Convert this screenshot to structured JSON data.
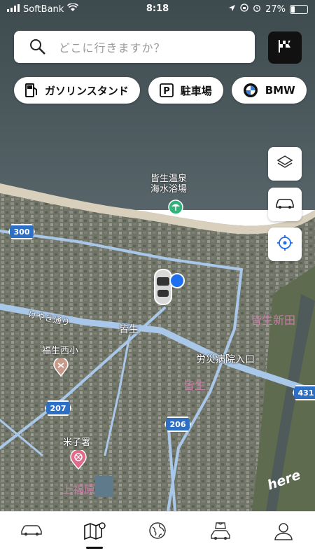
{
  "status_bar": {
    "carrier": "SoftBank",
    "time": "8:18",
    "battery": "27%",
    "battery_level": 0.27
  },
  "search": {
    "placeholder": "どこに行きますか？"
  },
  "chips": [
    {
      "label": "ガソリンスタンド",
      "icon": "gas-station-icon"
    },
    {
      "label": "駐車場",
      "icon": "parking-icon"
    },
    {
      "label": "BMW",
      "icon": "bmw-logo-icon"
    }
  ],
  "map_buttons": [
    {
      "name": "layers-button",
      "icon": "layers-icon"
    },
    {
      "name": "vehicle-button",
      "icon": "car-icon"
    },
    {
      "name": "locate-button",
      "icon": "location-target-icon"
    }
  ],
  "map_labels": {
    "onsen": "皆生温泉\n海水浴場",
    "keyaki": "けやき通り",
    "kaike": "皆生",
    "kaike_shinden": "皆生新田",
    "fukuseinishi": "福生西小",
    "rosai": "労災病院入口",
    "kaike_area": "皆生",
    "yonago_police": "米子署",
    "kamifukuhara": "上福原",
    "here": "here"
  },
  "route_shields": [
    "300",
    "207",
    "206",
    "431"
  ],
  "tabbar": [
    {
      "name": "tab-vehicle",
      "icon": "car-icon"
    },
    {
      "name": "tab-map",
      "icon": "map-icon",
      "active": true
    },
    {
      "name": "tab-explore",
      "icon": "globe-icon"
    },
    {
      "name": "tab-shop",
      "icon": "shopping-car-icon"
    },
    {
      "name": "tab-profile",
      "icon": "profile-icon"
    }
  ],
  "colors": {
    "accent": "#2d6fc4",
    "location_dot": "#1e6ef0",
    "poi_pink": "#e06a8a",
    "poi_green": "#2fb37a"
  }
}
